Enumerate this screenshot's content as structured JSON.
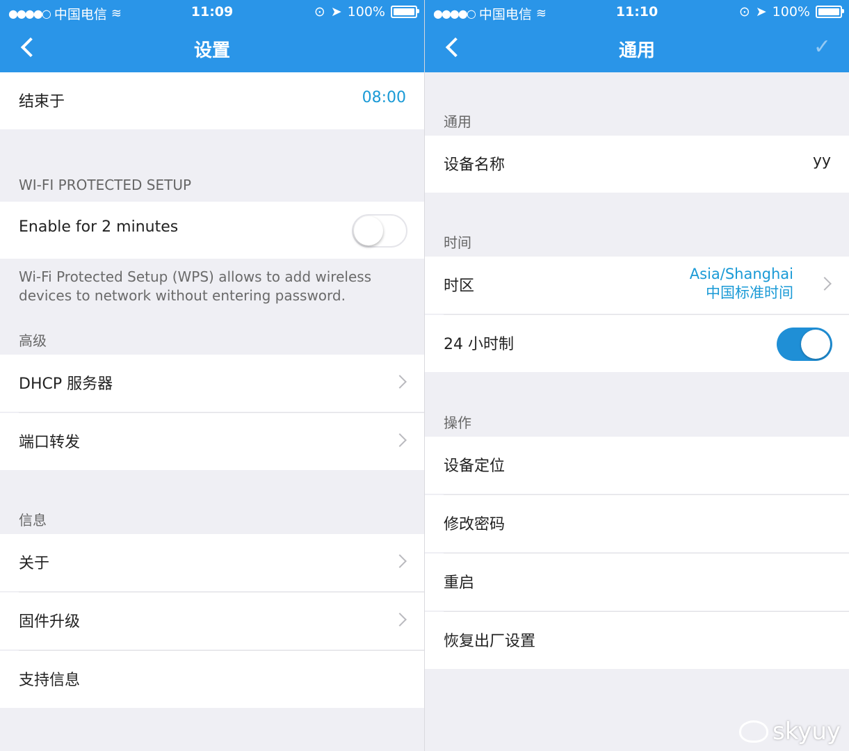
{
  "left": {
    "status": {
      "carrier": "中国电信",
      "time": "11:09",
      "battery": "100%"
    },
    "nav": {
      "title": "设置"
    },
    "rows": {
      "end_at": {
        "label": "结束于",
        "value": "08:00"
      },
      "wps_section": "WI-FI PROTECTED SETUP",
      "wps_toggle": {
        "label": "Enable for 2 minutes",
        "state": "off"
      },
      "wps_note": "Wi-Fi Protected Setup (WPS) allows to add wireless devices to network without entering password.",
      "advanced_section": "高级",
      "dhcp": "DHCP 服务器",
      "port_forward": "端口转发",
      "info_section": "信息",
      "about": "关于",
      "firmware": "固件升级",
      "support": "支持信息"
    }
  },
  "right": {
    "status": {
      "carrier": "中国电信",
      "time": "11:10",
      "battery": "100%"
    },
    "nav": {
      "title": "通用"
    },
    "rows": {
      "general_section": "通用",
      "device_name": {
        "label": "设备名称",
        "value": "yy"
      },
      "time_section": "时间",
      "timezone": {
        "label": "时区",
        "value_line1": "Asia/Shanghai",
        "value_line2": "中国标准时间"
      },
      "clock24": {
        "label": "24 小时制",
        "state": "on"
      },
      "ops_section": "操作",
      "locate": "设备定位",
      "change_password": "修改密码",
      "reboot": "重启",
      "factory_reset": "恢复出厂设置"
    }
  },
  "watermark": "skyuy",
  "colors": {
    "header": "#2a95e8",
    "accent": "#1a9ad6",
    "background": "#efeff4"
  }
}
